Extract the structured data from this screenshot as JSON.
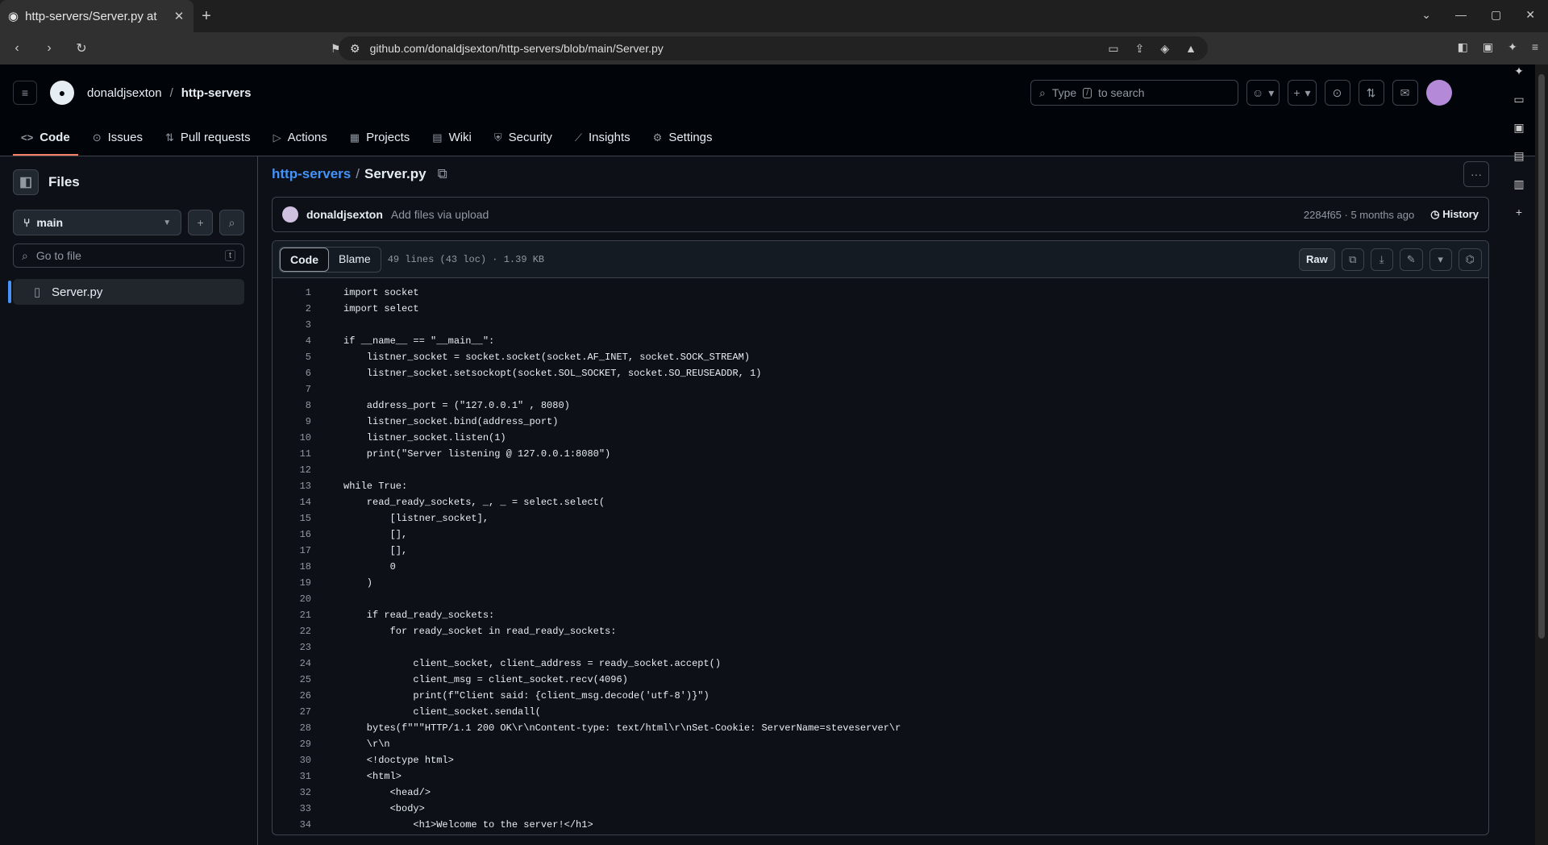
{
  "browser": {
    "tab_title": "http-servers/Server.py at",
    "url": "github.com/donaldjsexton/http-servers/blob/main/Server.py"
  },
  "header": {
    "owner": "donaldjsexton",
    "separator": "/",
    "repo": "http-servers",
    "search_placeholder_before": "Type",
    "search_key": "/",
    "search_placeholder_after": "to search"
  },
  "repo_nav": {
    "tabs": [
      {
        "label": "Code",
        "icon": "code-icon"
      },
      {
        "label": "Issues",
        "icon": "issue-icon"
      },
      {
        "label": "Pull requests",
        "icon": "pr-icon"
      },
      {
        "label": "Actions",
        "icon": "play-icon"
      },
      {
        "label": "Projects",
        "icon": "table-icon"
      },
      {
        "label": "Wiki",
        "icon": "book-icon"
      },
      {
        "label": "Security",
        "icon": "shield-icon"
      },
      {
        "label": "Insights",
        "icon": "graph-icon"
      },
      {
        "label": "Settings",
        "icon": "gear-icon"
      }
    ]
  },
  "sidebar": {
    "title": "Files",
    "branch": "main",
    "goto_placeholder": "Go to file",
    "goto_key": "t",
    "files": [
      "Server.py"
    ]
  },
  "file": {
    "repo_link": "http-servers",
    "separator": "/",
    "name": "Server.py",
    "commit_author": "donaldjsexton",
    "commit_message": "Add files via upload",
    "commit_meta": "2284f65 · 5 months ago",
    "history_label": "History",
    "view_code": "Code",
    "view_blame": "Blame",
    "info": "49 lines (43 loc) · 1.39 KB",
    "raw_label": "Raw"
  },
  "code_lines": [
    "import socket",
    "import select",
    "",
    "if __name__ == \"__main__\":",
    "    listner_socket = socket.socket(socket.AF_INET, socket.SOCK_STREAM)",
    "    listner_socket.setsockopt(socket.SOL_SOCKET, socket.SO_REUSEADDR, 1)",
    "",
    "    address_port = (\"127.0.0.1\" , 8080)",
    "    listner_socket.bind(address_port)",
    "    listner_socket.listen(1)",
    "    print(\"Server listening @ 127.0.0.1:8080\")",
    "",
    "while True:",
    "    read_ready_sockets, _, _ = select.select(",
    "        [listner_socket],",
    "        [],",
    "        [],",
    "        0",
    "    )",
    "",
    "    if read_ready_sockets:",
    "        for ready_socket in read_ready_sockets:",
    "",
    "            client_socket, client_address = ready_socket.accept()",
    "            client_msg = client_socket.recv(4096)",
    "            print(f\"Client said: {client_msg.decode('utf-8')}\")",
    "            client_socket.sendall(",
    "    bytes(f\"\"\"HTTP/1.1 200 OK\\r\\nContent-type: text/html\\r\\nSet-Cookie: ServerName=steveserver\\r",
    "    \\r\\n",
    "    <!doctype html>",
    "    <html>",
    "        <head/>",
    "        <body>",
    "            <h1>Welcome to the server!</h1>"
  ]
}
